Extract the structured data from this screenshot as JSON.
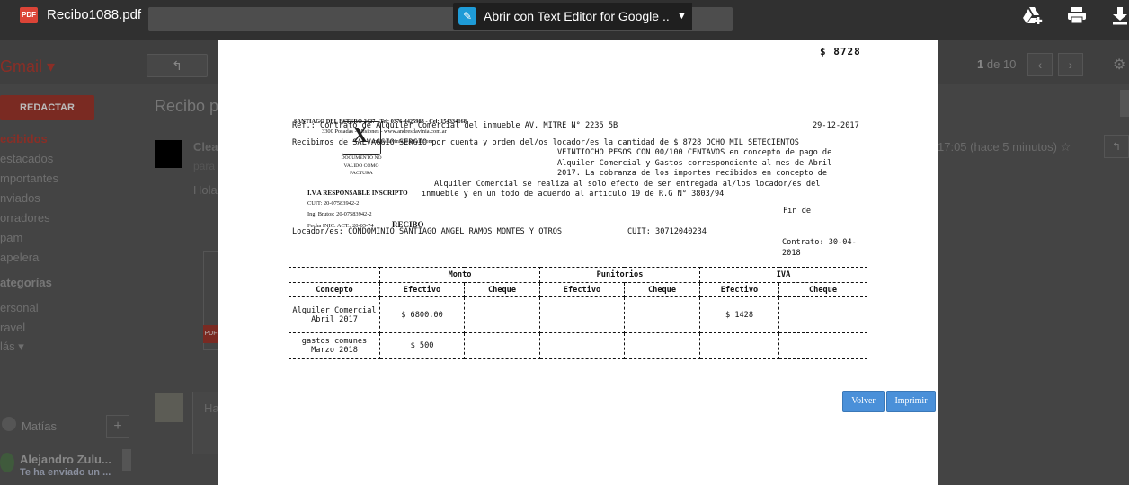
{
  "viewer": {
    "file_name": "Recibo1088.pdf",
    "pdf_badge": "PDF",
    "open_with_label": "Abrir con Text Editor for Google ...",
    "icons": {
      "open_with": "text-editor-icon",
      "dropdown": "chevron-down-icon",
      "add_to_drive": "add-to-drive-icon",
      "print": "print-icon",
      "download": "download-icon"
    }
  },
  "background": {
    "gmail_label": "Gmail ▾",
    "compose": "REDACTAR",
    "nav": [
      "ecibidos",
      "estacados",
      "mportantes",
      "nviados",
      "orradores",
      "pam",
      "apelera"
    ],
    "categories_title": "ategorías",
    "labels": [
      "ersonal",
      "ravel",
      "lás ▾"
    ],
    "subject": "Recibo p",
    "sender": "Clea",
    "to": "para",
    "body_start": "Hola",
    "time": "17:05 (hace 5 minutos) ☆",
    "page_count_current": "1",
    "page_count_text": "de 10",
    "reply_placeholder": "Ha",
    "contact": "Matías",
    "chat_name": "Alejandro Zulu...",
    "chat_message": "Te ha enviado un ...",
    "pdf_chip": "PDF"
  },
  "document": {
    "amount_top": "$ 8728",
    "issuer": {
      "name": "SANTIAGO DEL ESTERO 2427 - Tel: 0376-4425983 - Cel: 154334168",
      "address": "3300 Posadas - Misiones - www.andresdavinia.com.ar",
      "email": "andresdavinia@gmail.com",
      "doc_type_mark": "X",
      "not_valid": "DOCUMENTO NO VALIDO COMO FACTURA",
      "iva": "I.V.A RESPONSABLE INSCRIPTO",
      "cuit": "CUIT: 20-07583942-2",
      "ing_brutos": "Ing. Brutos: 20-07583942-2",
      "fecha_inic": "Fecha INIC. ACT.: 20-05-74",
      "recibo": "RECIBO"
    },
    "ref_line": "Ref.: Contrato de Alquiler Comercial del inmueble AV. MITRE N° 2235 5B",
    "date": "29-12-2017",
    "recibimos_line": "Recibimos de SALVAGGIO SERGIO por cuenta y orden del/os locador/es la cantidad de $ 8728 OCHO MIL SETECIENTOS",
    "concept_lines": [
      "VEINTIOCHO PESOS CON 00/100 CENTAVOS en concepto de pago de",
      "Alquiler Comercial y Gastos correspondiente al mes de Abril",
      "2017. La cobranza de los importes recibidos en concepto de"
    ],
    "alquiler_line": "Alquiler Comercial se realiza al solo efecto de ser entregada al/los locador/es del",
    "inmueble_line": "inmueble y en un todo de acuerdo al articulo 19 de R.G N° 3803/94",
    "fin_de": "Fin de",
    "locador_line": "Locador/es: CONDOMINIO SANTIAGO ANGEL RAMOS MONTES Y OTROS",
    "cuit_locador": "CUIT: 30712040234",
    "contrato_lines": [
      "Contrato: 30-04-",
      "2018"
    ],
    "table": {
      "group_headers": [
        "Monto",
        "Punitorios",
        "IVA"
      ],
      "sub_headers": [
        "Concepto",
        "Efectivo",
        "Cheque",
        "Efectivo",
        "Cheque",
        "Efectivo",
        "Cheque"
      ],
      "rows": [
        [
          "Alquiler Comercial Abril 2017",
          "$ 6800.00",
          "",
          "",
          "",
          "$ 1428",
          ""
        ],
        [
          "gastos comunes Marzo 2018",
          "$ 500",
          "",
          "",
          "",
          "",
          ""
        ]
      ]
    },
    "buttons": {
      "back": "Volver",
      "print": "Imprimir"
    }
  }
}
